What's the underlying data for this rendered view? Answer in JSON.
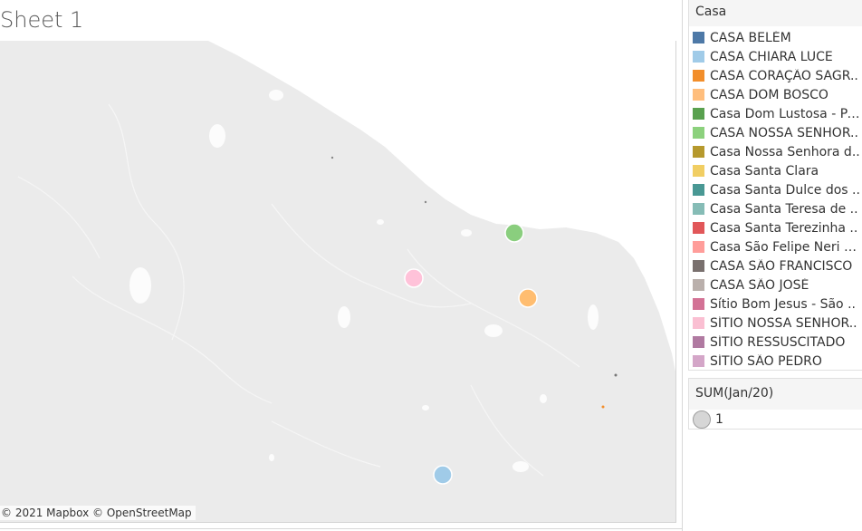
{
  "sheet": {
    "title": "Sheet 1"
  },
  "map": {
    "attribution": "© 2021 Mapbox © OpenStreetMap",
    "colors": {
      "land": "#ebebeb",
      "sea": "#ffffff",
      "water_features": "#ffffff"
    },
    "markers": [
      {
        "casa": "CASA NOSSA SENHOR..",
        "color": "#8ace7e"
      },
      {
        "casa": "SÍTIO NOSSA SENHOR..",
        "color": "#ffc2d9"
      },
      {
        "casa": "CASA DOM BOSCO",
        "color": "#ffbd70"
      },
      {
        "casa": "CASA CHIARA LUCE",
        "color": "#a0cbe8"
      }
    ]
  },
  "legend": {
    "title": "Casa",
    "items": [
      {
        "label": "CASA BELÉM",
        "color": "#4e79a7"
      },
      {
        "label": "CASA CHIARA LUCE",
        "color": "#a0cbe8"
      },
      {
        "label": "CASA CORAÇÃO SAGR..",
        "color": "#f28e2b"
      },
      {
        "label": "CASA DOM BOSCO",
        "color": "#ffbe7d"
      },
      {
        "label": "Casa Dom Lustosa - Pa..",
        "color": "#59a14f"
      },
      {
        "label": "CASA NOSSA SENHOR..",
        "color": "#8cd17d"
      },
      {
        "label": "Casa Nossa Senhora d..",
        "color": "#b6992d"
      },
      {
        "label": "Casa Santa Clara",
        "color": "#f1ce63"
      },
      {
        "label": "Casa Santa Dulce dos ..",
        "color": "#499894"
      },
      {
        "label": "Casa Santa Teresa de ..",
        "color": "#86bcb6"
      },
      {
        "label": "Casa Santa Terezinha ..",
        "color": "#e15759"
      },
      {
        "label": "Casa São Felipe Neri - ..",
        "color": "#ff9d9a"
      },
      {
        "label": "CASA SÃO FRANCISCO",
        "color": "#79706e"
      },
      {
        "label": "CASA SÃO JOSÉ",
        "color": "#bab0ac"
      },
      {
        "label": "Sítio Bom Jesus - São ..",
        "color": "#d37295"
      },
      {
        "label": "SÍTIO NOSSA SENHOR..",
        "color": "#fabfd2"
      },
      {
        "label": "SÍTIO RESSUSCITADO",
        "color": "#b07aa1"
      },
      {
        "label": "SÍTIO SÃO PEDRO",
        "color": "#d4a6c8"
      }
    ]
  },
  "size_legend": {
    "title": "SUM(Jan/20)",
    "value": "1"
  }
}
